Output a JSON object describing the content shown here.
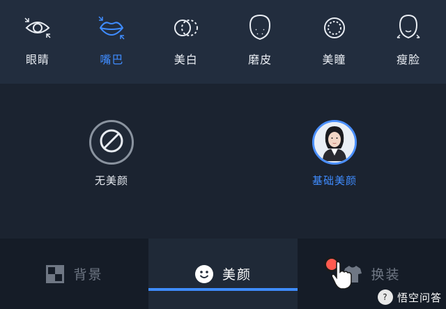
{
  "features": [
    {
      "label": "眼睛",
      "icon": "eye-icon",
      "active": false
    },
    {
      "label": "嘴巴",
      "icon": "lips-icon",
      "active": true
    },
    {
      "label": "美白",
      "icon": "whiten-icon",
      "active": false
    },
    {
      "label": "磨皮",
      "icon": "smooth-skin-icon",
      "active": false
    },
    {
      "label": "美瞳",
      "icon": "pupil-icon",
      "active": false
    },
    {
      "label": "瘦脸",
      "icon": "slim-face-icon",
      "active": false
    }
  ],
  "options": {
    "none_label": "无美颜",
    "basic_label": "基础美颜"
  },
  "tabs": [
    {
      "label": "背景",
      "icon": "background-icon",
      "active": false
    },
    {
      "label": "美颜",
      "icon": "smile-icon",
      "active": true
    },
    {
      "label": "换装",
      "icon": "shirt-icon",
      "active": false
    }
  ],
  "watermark": "悟空问答",
  "colors": {
    "accent": "#3f8cff",
    "topbar": "#222d3e",
    "background": "#1b2330",
    "tabbar": "#151c27"
  }
}
